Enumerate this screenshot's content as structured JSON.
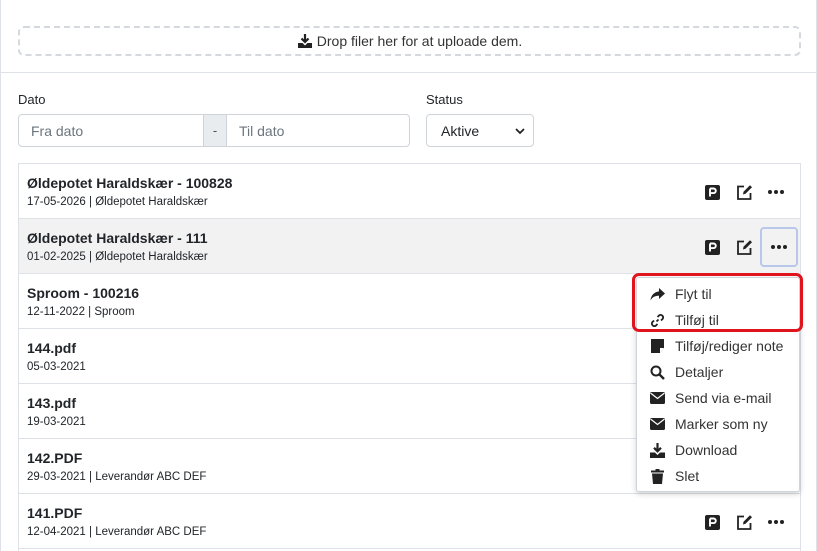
{
  "upload": {
    "text": "Drop filer her for at uploade dem.",
    "icon": "upload-icon"
  },
  "filters": {
    "date_label": "Dato",
    "from_placeholder": "Fra dato",
    "separator": "-",
    "to_placeholder": "Til dato",
    "status_label": "Status",
    "status_value": "Aktive"
  },
  "rows": [
    {
      "title": "Øldepotet Haraldskær - 100828",
      "sub": "17-05-2026 | Øldepotet Haraldskær"
    },
    {
      "title": "Øldepotet Haraldskær - 111",
      "sub": "01-02-2025 | Øldepotet Haraldskær"
    },
    {
      "title": "Sproom - 100216",
      "sub": "12-11-2022 | Sproom"
    },
    {
      "title": "144.pdf",
      "sub": "05-03-2021"
    },
    {
      "title": "143.pdf",
      "sub": "19-03-2021"
    },
    {
      "title": "142.PDF",
      "sub": "29-03-2021 | Leverandør ABC DEF"
    },
    {
      "title": "141.PDF",
      "sub": "12-04-2021 | Leverandør ABC DEF"
    }
  ],
  "menu": {
    "items": [
      {
        "label": "Flyt til",
        "icon": "share-arrow-icon"
      },
      {
        "label": "Tilføj til",
        "icon": "link-icon"
      },
      {
        "label": "Tilføj/rediger note",
        "icon": "note-icon"
      },
      {
        "label": "Detaljer",
        "icon": "search-icon"
      },
      {
        "label": "Send via e-mail",
        "icon": "envelope-icon"
      },
      {
        "label": "Marker som ny",
        "icon": "envelope-icon"
      },
      {
        "label": "Download",
        "icon": "download-icon"
      },
      {
        "label": "Slet",
        "icon": "trash-icon"
      }
    ]
  },
  "colors": {
    "highlight": "#e0141c",
    "focus_ring": "#b9c7ea",
    "active_row": "#f2f2f2"
  }
}
